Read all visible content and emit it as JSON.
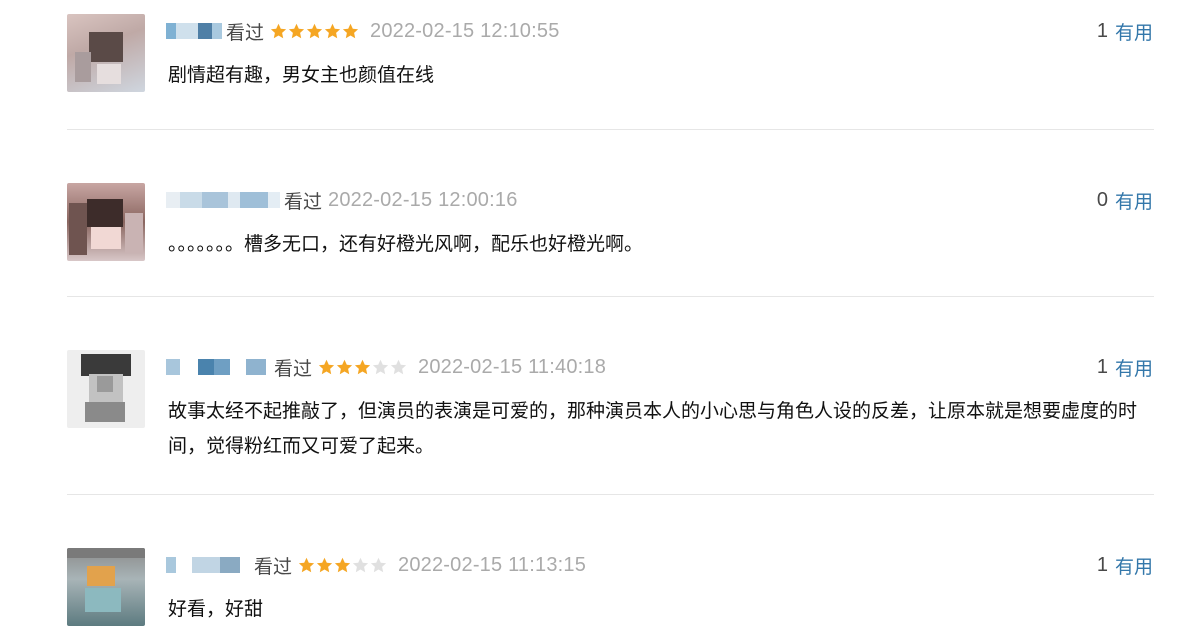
{
  "comments": [
    {
      "seen_label": "看过",
      "rating": 5,
      "time": "2022-02-15 12:10:55",
      "useful_count": "1",
      "useful_label": "有用",
      "text": "剧情超有趣，男女主也颜值在线"
    },
    {
      "seen_label": "看过",
      "rating": 0,
      "time": "2022-02-15 12:00:16",
      "useful_count": "0",
      "useful_label": "有用",
      "text": "。。。。。。。槽多无口，还有好橙光风啊，配乐也好橙光啊。"
    },
    {
      "seen_label": "看过",
      "rating": 3,
      "time": "2022-02-15 11:40:18",
      "useful_count": "1",
      "useful_label": "有用",
      "text": "故事太经不起推敲了，但演员的表演是可爱的，那种演员本人的小心思与角色人设的反差，让原本就是想要虚度的时间，觉得粉红而又可爱了起来。"
    },
    {
      "seen_label": "看过",
      "rating": 3,
      "time": "2022-02-15 11:13:15",
      "useful_count": "1",
      "useful_label": "有用",
      "text": "好看，好甜"
    }
  ],
  "colors": {
    "star_on": "#f5a623",
    "star_off": "#e0e0e0",
    "useful_link": "#3377aa",
    "time": "#aaaaaa"
  },
  "icons": {
    "star": "star-icon",
    "avatar": "user-avatar-blurred"
  }
}
